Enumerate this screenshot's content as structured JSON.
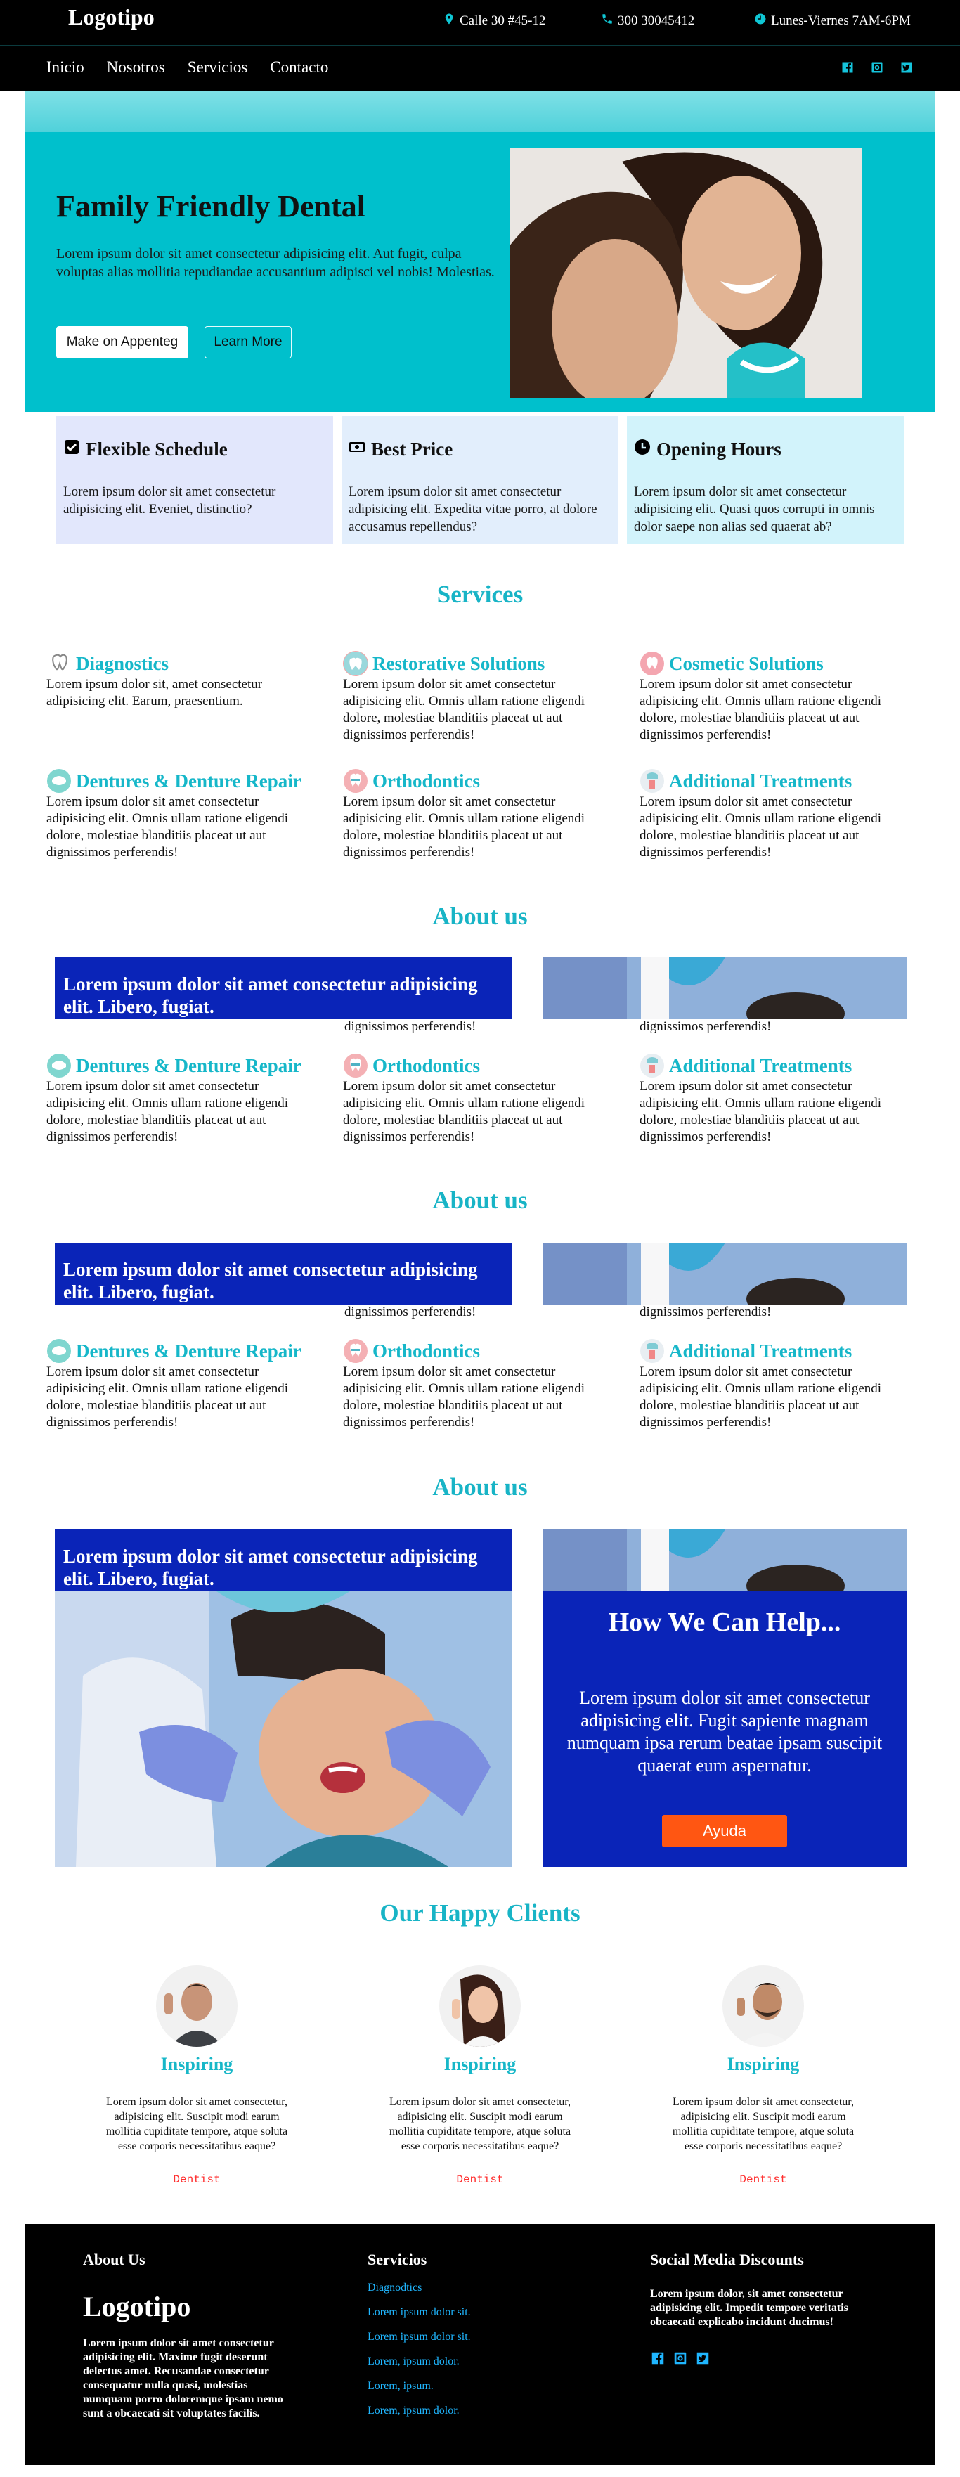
{
  "topbar": {
    "logo": "Logotipo",
    "address": "Calle 30 #45-12",
    "phone": "300 30045412",
    "hours": "Lunes-Viernes 7AM-6PM"
  },
  "nav": {
    "items": [
      "Inicio",
      "Nosotros",
      "Servicios",
      "Contacto"
    ],
    "social": [
      "facebook-icon",
      "instagram-icon",
      "twitter-icon"
    ]
  },
  "hero": {
    "title": "Family Friendly Dental",
    "text": "Lorem ipsum dolor sit amet consectetur adipisicing elit. Aut fugit, culpa voluptas alias mollitia repudiandae accusantium adipisci vel nobis! Molestias.",
    "primary_button": "Make on Appenteg",
    "secondary_button": "Learn More"
  },
  "features": [
    {
      "title": "Flexible Schedule",
      "icon": "check-square-icon",
      "bg": "#e2e7fc",
      "text": "Lorem ipsum dolor sit amet consectetur adipisicing elit. Eveniet, distinctio?"
    },
    {
      "title": "Best Price",
      "icon": "money-icon",
      "bg": "#e2eefc",
      "text": "Lorem ipsum dolor sit amet consectetur adipisicing elit. Expedita vitae porro, at dolore accusamus repellendus?"
    },
    {
      "title": "Opening Hours",
      "icon": "clock-icon",
      "bg": "#d2f3fb",
      "text": "Lorem ipsum dolor sit amet consectetur adipisicing elit. Quasi quos corrupti in omnis dolor saepe non alias sed quaerat ab?"
    }
  ],
  "services_title": "Services",
  "services": [
    {
      "name": "Diagnostics",
      "text": "Lorem ipsum dolor sit, amet consectetur adipisicing elit. Earum, praesentium."
    },
    {
      "name": "Restorative Solutions",
      "text": "Lorem ipsum dolor sit amet consectetur adipisicing elit. Omnis ullam ratione eligendi dolore, molestiae blanditiis placeat ut aut dignissimos perferendis!"
    },
    {
      "name": "Cosmetic Solutions",
      "text": "Lorem ipsum dolor sit amet consectetur adipisicing elit. Omnis ullam ratione eligendi dolore, molestiae blanditiis placeat ut aut dignissimos perferendis!"
    },
    {
      "name": "Dentures & Denture Repair",
      "text": "Lorem ipsum dolor sit amet consectetur adipisicing elit. Omnis ullam ratione eligendi dolore, molestiae blanditiis placeat ut aut dignissimos perferendis!"
    },
    {
      "name": "Orthodontics",
      "text": "Lorem ipsum dolor sit amet consectetur adipisicing elit. Omnis ullam ratione eligendi dolore, molestiae blanditiis placeat ut aut dignissimos perferendis!"
    },
    {
      "name": "Additional Treatments",
      "text": "Lorem ipsum dolor sit amet consectetur adipisicing elit. Omnis ullam ratione eligendi dolore, molestiae blanditiis placeat ut aut dignissimos perferendis!"
    }
  ],
  "about": {
    "title": "About us",
    "banner": "Lorem ipsum dolor sit amet consectetur adipisicing elit. Libero, fugiat.",
    "clipped": "dignissimos perferendis!"
  },
  "help": {
    "title": "How We Can Help...",
    "text": "Lorem ipsum dolor sit amet consectetur adipisicing elit. Fugit sapiente magnam numquam ipsa rerum beatae ipsam suscipit quaerat eum aspernatur.",
    "button": "Ayuda"
  },
  "clients": {
    "title": "Our Happy Clients",
    "items": [
      {
        "name": "Inspiring",
        "quote": "Lorem ipsum dolor sit amet consectetur, adipisicing elit. Suscipit modi earum mollitia cupiditate tempore, atque soluta esse corporis necessitatibus eaque?",
        "role": "Dentist"
      },
      {
        "name": "Inspiring",
        "quote": "Lorem ipsum dolor sit amet consectetur, adipisicing elit. Suscipit modi earum mollitia cupiditate tempore, atque soluta esse corporis necessitatibus eaque?",
        "role": "Dentist"
      },
      {
        "name": "Inspiring",
        "quote": "Lorem ipsum dolor sit amet consectetur, adipisicing elit. Suscipit modi earum mollitia cupiditate tempore, atque soluta esse corporis necessitatibus eaque?",
        "role": "Dentist"
      }
    ]
  },
  "footer": {
    "about_title": "About Us",
    "logo": "Logotipo",
    "about_text": "Lorem ipsum dolor sit amet consectetur adipisicing elit. Maxime fugit deserunt delectus amet. Recusandae consectetur consequatur nulla quasi, molestias numquam porro doloremque ipsam nemo sunt a obcaecati sit voluptates facilis.",
    "services_title": "Servicios",
    "services_links": [
      "Diagnodtics",
      "Lorem ipsum dolor sit.",
      "Lorem ipsum dolor sit.",
      "Lorem, ipsum dolor.",
      "Lorem, ipsum.",
      "Lorem, ipsum dolor."
    ],
    "social_title": "Social Media Discounts",
    "social_text": "Lorem ipsum dolor, sit amet consectetur adipisicing elit. Impedit tempore veritatis obcaecati explicabo incidunt ducimus!"
  },
  "colors": {
    "accent": "#00c0cc",
    "heading": "#18b4c6",
    "banner": "#0a24b8",
    "cta": "#ff5612",
    "role": "#ff2f2f",
    "footer_link": "#1fb6ff"
  }
}
